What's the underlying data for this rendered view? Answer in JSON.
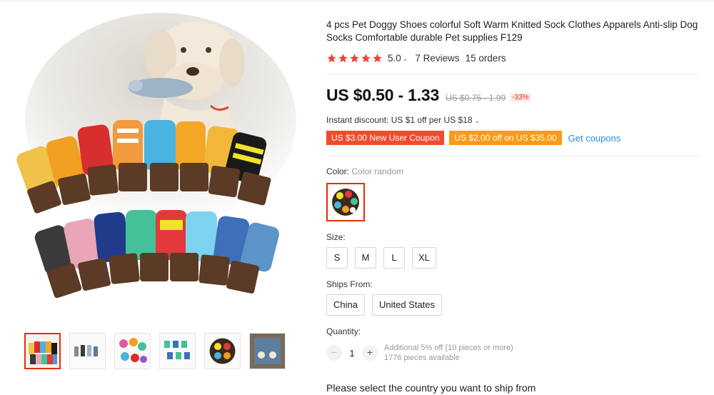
{
  "product": {
    "title": "4 pcs Pet Doggy Shoes colorful Soft Warm Knitted Sock Clothes Apparels Anti-slip Dog Socks Comfortable durable Pet supplies F129",
    "rating_value": "5.0",
    "reviews_text": "7 Reviews",
    "orders_text": "15 orders",
    "star_color": "#f0433a",
    "stars_filled": 5
  },
  "pricing": {
    "price": "US $0.50 - 1.33",
    "original_price": "US $0.75 - 1.99",
    "discount_pct": "-33%",
    "instant_discount": "Instant discount: US $1 off per US $18"
  },
  "coupons": {
    "new_user": "US $3.00 New User Coupon",
    "store": "US $2.00 off on US $35.00",
    "get_coupons": "Get coupons"
  },
  "color": {
    "label": "Color:",
    "selected_value": "Color random"
  },
  "size": {
    "label": "Size:",
    "options": [
      "S",
      "M",
      "L",
      "XL"
    ]
  },
  "ships_from": {
    "label": "Ships From:",
    "options": [
      "China",
      "United States"
    ]
  },
  "quantity": {
    "label": "Quantity:",
    "value": "1",
    "minus": "−",
    "plus": "+",
    "note_line1": "Additional 5% off (10 pieces or more)",
    "note_line2": "1776 pieces available"
  },
  "shipping_note": "Please select the country you want to ship from",
  "gallery": {
    "thumbnail_count": 6,
    "active_index": 0
  },
  "colors": {
    "accent_red": "#e62e04",
    "coupon_red": "#f44a2c",
    "coupon_orange": "#f99b14",
    "link_blue": "#2e8ce0"
  }
}
